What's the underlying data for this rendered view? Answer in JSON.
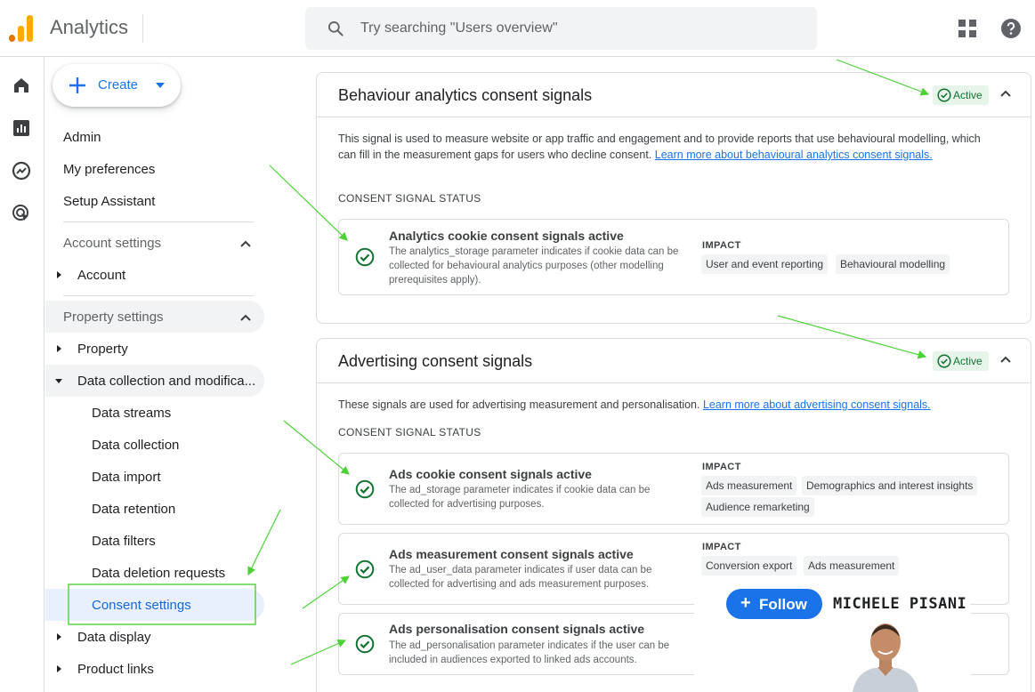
{
  "app": {
    "title": "Analytics"
  },
  "search": {
    "placeholder": "Try searching \"Users overview\""
  },
  "sidebar": {
    "create_label": "Create",
    "items": {
      "admin": "Admin",
      "preferences": "My preferences",
      "setup": "Setup Assistant",
      "account_settings": "Account settings",
      "account": "Account",
      "property_settings": "Property settings",
      "property": "Property",
      "data_collection_mod": "Data collection and modifica...",
      "data_streams": "Data streams",
      "data_collection": "Data collection",
      "data_import": "Data import",
      "data_retention": "Data retention",
      "data_filters": "Data filters",
      "data_deletion": "Data deletion requests",
      "consent_settings": "Consent settings",
      "data_display": "Data display",
      "product_links": "Product links"
    }
  },
  "cards": {
    "behaviour": {
      "title": "Behaviour analytics consent signals",
      "badge": "Active",
      "description": "This signal is used to measure website or app traffic and engagement and to provide reports that use behavioural modelling, which can fill in the measurement gaps for users who decline consent. ",
      "link": "Learn more about behavioural analytics consent signals.",
      "status_label": "CONSENT SIGNAL STATUS",
      "signal": {
        "title": "Analytics cookie consent signals active",
        "description": "The analytics_storage parameter indicates if cookie data can be collected for behavioural analytics purposes (other modelling prerequisites apply).",
        "impact_label": "IMPACT",
        "chips": [
          "User and event reporting",
          "Behavioural modelling"
        ]
      }
    },
    "advertising": {
      "title": "Advertising consent signals",
      "badge": "Active",
      "description": "These signals are used for advertising measurement and personalisation. ",
      "link": "Learn more about advertising consent signals.",
      "status_label": "CONSENT SIGNAL STATUS",
      "signals": [
        {
          "title": "Ads cookie consent signals active",
          "description": "The ad_storage parameter indicates if cookie data can be collected for advertising purposes.",
          "impact_label": "IMPACT",
          "chips": [
            "Ads measurement",
            "Demographics and interest insights",
            "Audience remarketing"
          ]
        },
        {
          "title": "Ads measurement consent signals active",
          "description": "The ad_user_data parameter indicates if user data can be collected for advertising and ads measurement purposes.",
          "impact_label": "IMPACT",
          "chips": [
            "Conversion export",
            "Ads measurement"
          ]
        },
        {
          "title": "Ads personalisation consent signals active",
          "description": "The ad_personalisation parameter indicates if the user can be included in audiences exported to linked ads accounts."
        }
      ]
    }
  },
  "overlay": {
    "follow_label": "Follow",
    "author": "MICHELE PISANI"
  },
  "colors": {
    "accent": "#1a73e8",
    "active_green": "#137333",
    "annotation_green": "#4cd137",
    "logo_orange": "#f9ab00",
    "logo_dark": "#e37400"
  }
}
